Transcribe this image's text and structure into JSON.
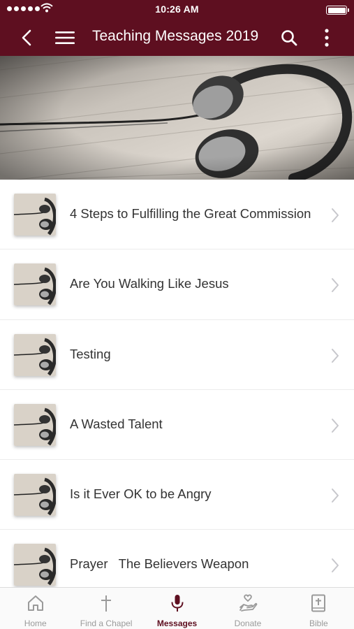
{
  "status_bar": {
    "time": "10:26 AM"
  },
  "nav": {
    "title": "Teaching Messages 2019"
  },
  "messages": [
    {
      "title": "4 Steps to Fulfilling the Great Commission"
    },
    {
      "title": "Are You Walking Like Jesus"
    },
    {
      "title": "Testing"
    },
    {
      "title": "A Wasted Talent"
    },
    {
      "title": "Is it Ever OK to be Angry"
    },
    {
      "title": "Prayer   The Believers Weapon"
    }
  ],
  "tabs": [
    {
      "label": "Home",
      "icon": "home-icon"
    },
    {
      "label": "Find a Chapel",
      "icon": "cross-icon"
    },
    {
      "label": "Messages",
      "icon": "microphone-icon",
      "active": true
    },
    {
      "label": "Donate",
      "icon": "donate-hand-icon"
    },
    {
      "label": "Bible",
      "icon": "bible-icon"
    }
  ],
  "colors": {
    "brand": "#5e0f20",
    "tab_inactive": "#9a9a9a",
    "text": "#333333"
  }
}
